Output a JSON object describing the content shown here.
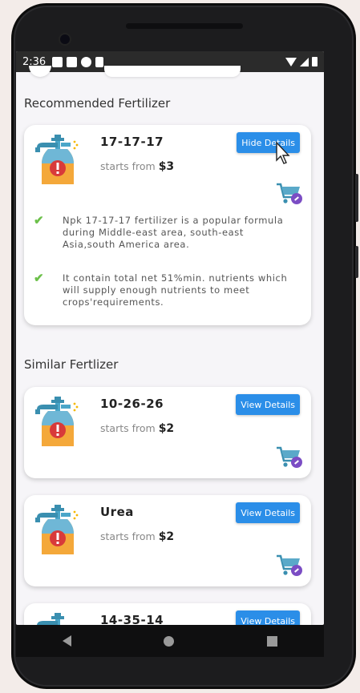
{
  "status_bar": {
    "time": "2:36"
  },
  "recommended": {
    "section_title": "Recommended Fertilizer",
    "name": "17-17-17",
    "price_prefix": "starts from",
    "price": "$3",
    "button_label": "Hide Details",
    "details": [
      "Npk 17-17-17 fertilizer is a popular formula during Middle-east area, south-east Asia,south America area.",
      "It contain total net 51%min. nutrients which will supply enough nutrients to meet crops'requirements."
    ]
  },
  "similar": {
    "section_title": "Similar Fertlizer",
    "items": [
      {
        "name": "10-26-26",
        "price_prefix": "starts from",
        "price": "$2",
        "button_label": "View Details"
      },
      {
        "name": "Urea",
        "price_prefix": "starts from",
        "price": "$2",
        "button_label": "View Details"
      },
      {
        "name": "14-35-14",
        "price_prefix": "",
        "price": "",
        "button_label": "View Details"
      }
    ]
  },
  "colors": {
    "accent": "#2b8ee8",
    "check": "#6cc04a",
    "cart": "#3a8fb0",
    "badge": "#7b4dc4"
  },
  "icons": {
    "product": "fertilizer-sprayer-icon",
    "cart": "add-to-cart-icon",
    "bullet": "check-icon"
  }
}
